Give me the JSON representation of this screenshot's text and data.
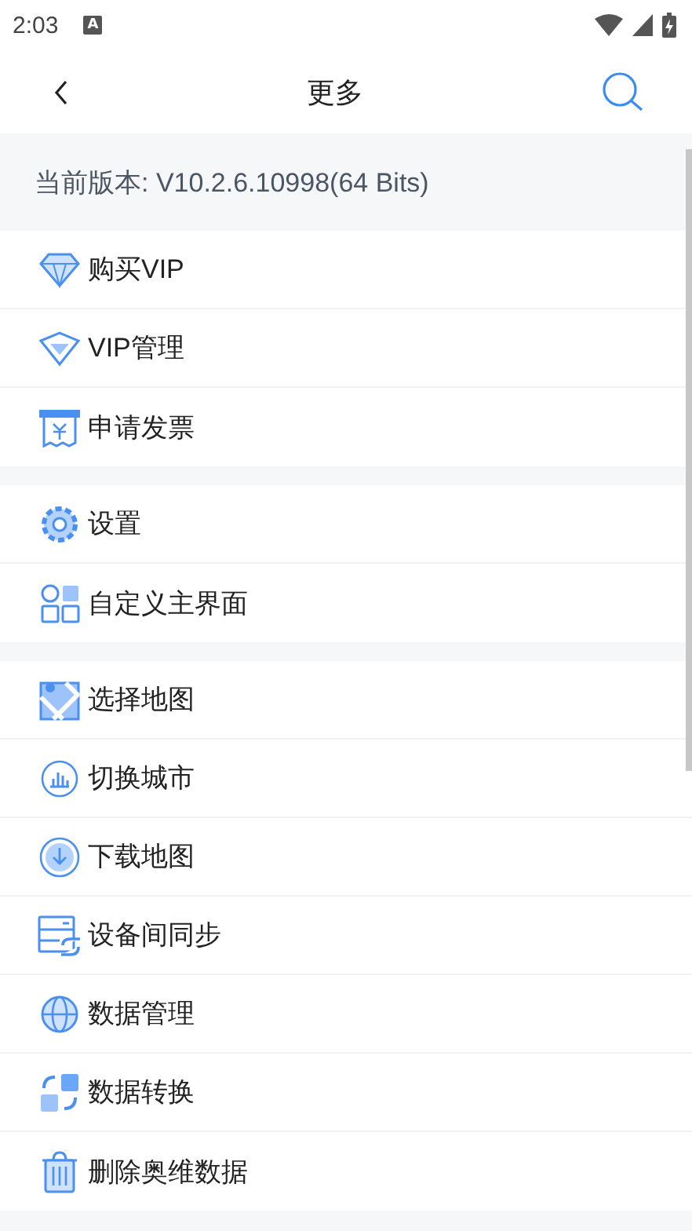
{
  "status_bar": {
    "time": "2:03",
    "notification": "A"
  },
  "header": {
    "title": "更多"
  },
  "version": "当前版本: V10.2.6.10998(64 Bits)",
  "groups": [
    {
      "items": [
        "购买VIP",
        "VIP管理",
        "申请发票"
      ]
    },
    {
      "items": [
        "设置",
        "自定义主界面"
      ]
    },
    {
      "items": [
        "选择地图",
        "切换城市",
        "下载地图",
        "设备间同步",
        "数据管理",
        "数据转换",
        "删除奥维数据"
      ]
    }
  ]
}
